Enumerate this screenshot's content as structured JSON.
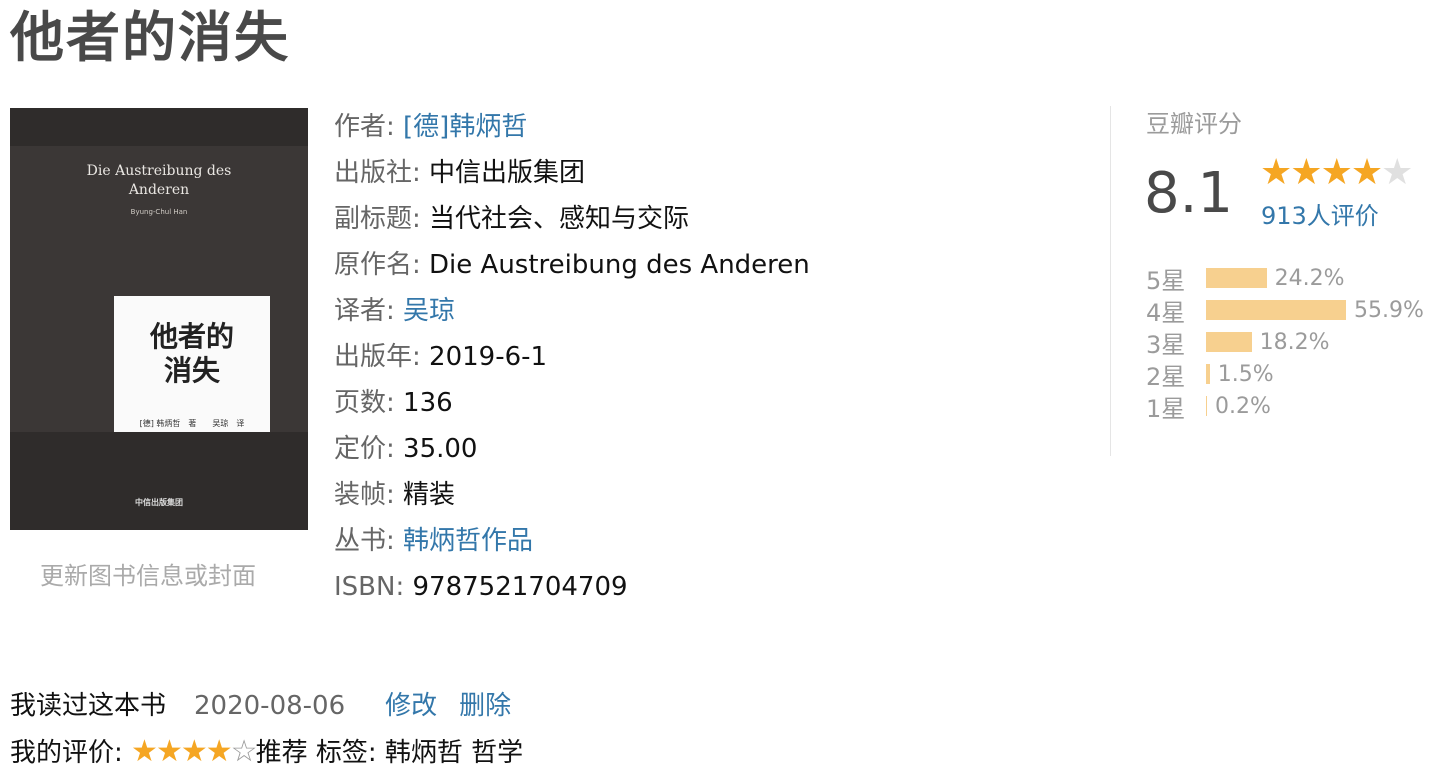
{
  "title": "他者的消失",
  "cover": {
    "en_title_line1": "Die Austreibung des",
    "en_title_line2": "Anderen",
    "en_author": "Byung-Chul Han",
    "cn_title_line1": "他者的",
    "cn_title_line2": "消失",
    "cn_meta": "[德] 韩炳哲　著　　吴琼　译",
    "publisher": "中信出版集团",
    "update_link": "更新图书信息或封面"
  },
  "info": [
    {
      "label": "作者:",
      "value": "[德]韩炳哲",
      "link": true
    },
    {
      "label": "出版社:",
      "value": "中信出版集团",
      "link": false
    },
    {
      "label": "副标题:",
      "value": "当代社会、感知与交际",
      "link": false
    },
    {
      "label": "原作名:",
      "value": "Die Austreibung des Anderen",
      "link": false
    },
    {
      "label": "译者:",
      "value": "吴琼",
      "link": true
    },
    {
      "label": "出版年:",
      "value": "2019-6-1",
      "link": false
    },
    {
      "label": "页数:",
      "value": "136",
      "link": false
    },
    {
      "label": "定价:",
      "value": "35.00",
      "link": false
    },
    {
      "label": "装帧:",
      "value": "精装",
      "link": false
    },
    {
      "label": "丛书:",
      "value": "韩炳哲作品",
      "link": true
    },
    {
      "label": "ISBN:",
      "value": "9787521704709",
      "link": false
    }
  ],
  "rating": {
    "heading": "豆瓣评分",
    "score": "8.1",
    "stars": 4,
    "count_text": "913人评价",
    "distribution": [
      {
        "label": "5星",
        "percent": 24.2,
        "text": "24.2%"
      },
      {
        "label": "4星",
        "percent": 55.9,
        "text": "55.9%"
      },
      {
        "label": "3星",
        "percent": 18.2,
        "text": "18.2%"
      },
      {
        "label": "2星",
        "percent": 1.5,
        "text": "1.5%"
      },
      {
        "label": "1星",
        "percent": 0.2,
        "text": "0.2%"
      }
    ]
  },
  "my_status": {
    "status": "我读过这本书",
    "date": "2020-08-06",
    "edit": "修改",
    "delete": "删除"
  },
  "my_rating": {
    "label": "我的评价:",
    "stars": 4,
    "recommend": "推荐",
    "tags_label": "标签:",
    "tags": "韩炳哲 哲学"
  },
  "colors": {
    "link": "#3377aa",
    "bar": "#f7d08f",
    "star": "#f5a623"
  }
}
